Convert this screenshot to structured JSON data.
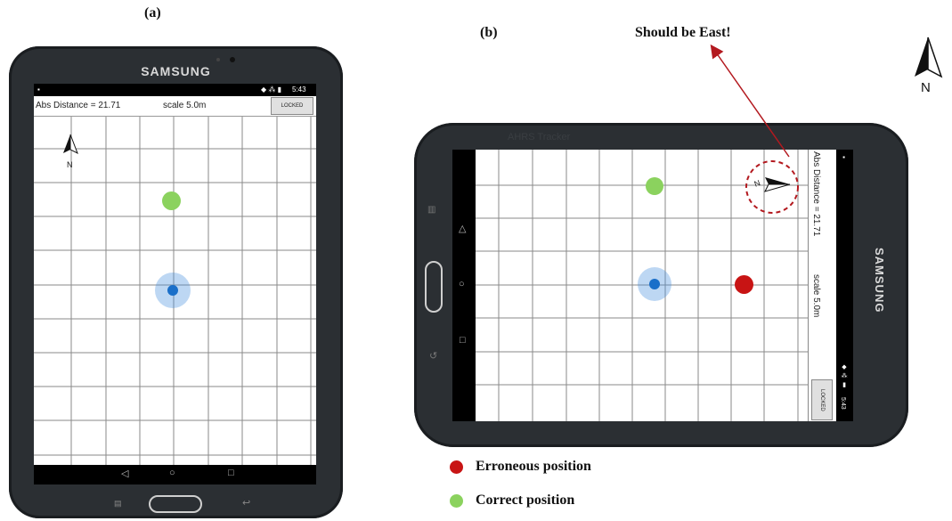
{
  "labels": {
    "panel_a": "(a)",
    "panel_b": "(b)",
    "annotation": "Should be East!",
    "compass_n": "N"
  },
  "device": {
    "brand": "SAMSUNG"
  },
  "app": {
    "status_time": "5:43",
    "abs_distance": "Abs Distance = 21.71",
    "scale": "scale 5.0m",
    "locked_button": "LOCKED",
    "app_name_faded": "AHRS Tracker"
  },
  "legend": {
    "items": [
      {
        "label": "Erroneous  position",
        "color": "#c81414"
      },
      {
        "label": "Correct position",
        "color": "#8bd25e"
      }
    ]
  },
  "colors": {
    "user_position": "#1a6fc9",
    "correct": "#8bd25e",
    "erroneous": "#c81414",
    "annotation_arrow": "#b3191f"
  }
}
